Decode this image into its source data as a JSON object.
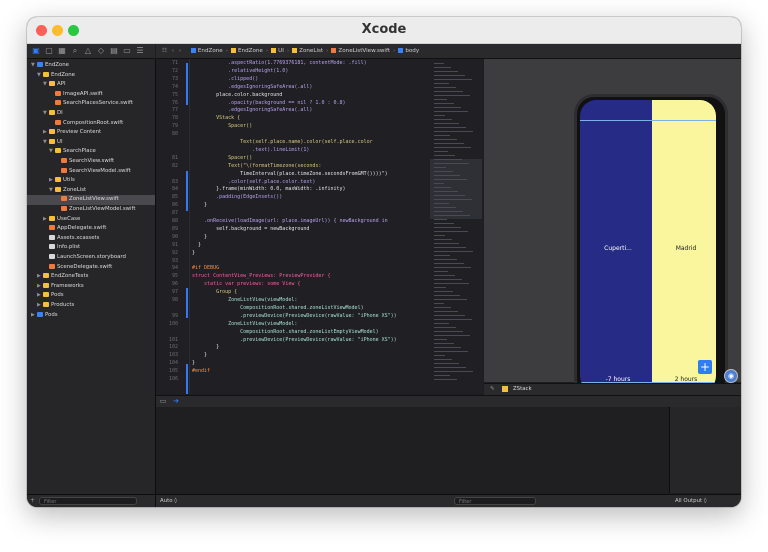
{
  "window": {
    "title": "Xcode"
  },
  "jumpbar": {
    "items": [
      "EndZone",
      "EndZone",
      "UI",
      "ZoneList",
      "ZoneListView.swift",
      "body"
    ]
  },
  "navigator": {
    "filter_placeholder": "Filter",
    "items": [
      {
        "label": "EndZone",
        "level": 0,
        "kind": "proj",
        "arrow": "▼"
      },
      {
        "label": "EndZone",
        "level": 1,
        "kind": "folder",
        "arrow": "▼"
      },
      {
        "label": "API",
        "level": 2,
        "kind": "folder",
        "arrow": "▼"
      },
      {
        "label": "ImageAPI.swift",
        "level": 3,
        "kind": "swift",
        "arrow": ""
      },
      {
        "label": "SearchPlacesService.swift",
        "level": 3,
        "kind": "swift",
        "arrow": ""
      },
      {
        "label": "DI",
        "level": 2,
        "kind": "folder",
        "arrow": "▼"
      },
      {
        "label": "CompositionRoot.swift",
        "level": 3,
        "kind": "swift",
        "arrow": ""
      },
      {
        "label": "Preview Content",
        "level": 2,
        "kind": "folder",
        "arrow": "▶"
      },
      {
        "label": "UI",
        "level": 2,
        "kind": "folder",
        "arrow": "▼"
      },
      {
        "label": "SearchPlace",
        "level": 3,
        "kind": "folder",
        "arrow": "▼"
      },
      {
        "label": "SearchView.swift",
        "level": 4,
        "kind": "swift",
        "arrow": ""
      },
      {
        "label": "SearchViewModel.swift",
        "level": 4,
        "kind": "swift",
        "arrow": ""
      },
      {
        "label": "Utils",
        "level": 3,
        "kind": "folder",
        "arrow": "▶"
      },
      {
        "label": "ZoneList",
        "level": 3,
        "kind": "folder",
        "arrow": "▼"
      },
      {
        "label": "ZoneListView.swift",
        "level": 4,
        "kind": "swift",
        "arrow": "",
        "selected": true
      },
      {
        "label": "ZoneListViewModel.swift",
        "level": 4,
        "kind": "swift",
        "arrow": ""
      },
      {
        "label": "UseCase",
        "level": 2,
        "kind": "folder",
        "arrow": "▶"
      },
      {
        "label": "AppDelegate.swift",
        "level": 2,
        "kind": "swift",
        "arrow": ""
      },
      {
        "label": "Assets.xcassets",
        "level": 2,
        "kind": "file",
        "arrow": ""
      },
      {
        "label": "Info.plist",
        "level": 2,
        "kind": "file",
        "arrow": ""
      },
      {
        "label": "LaunchScreen.storyboard",
        "level": 2,
        "kind": "file",
        "arrow": ""
      },
      {
        "label": "SceneDelegate.swift",
        "level": 2,
        "kind": "swift",
        "arrow": ""
      },
      {
        "label": "EndZoneTests",
        "level": 1,
        "kind": "folder",
        "arrow": "▶"
      },
      {
        "label": "Frameworks",
        "level": 1,
        "kind": "folder",
        "arrow": "▶"
      },
      {
        "label": "Pods",
        "level": 1,
        "kind": "folder",
        "arrow": "▶"
      },
      {
        "label": "Products",
        "level": 1,
        "kind": "folder",
        "arrow": "▶"
      },
      {
        "label": "Pods",
        "level": 0,
        "kind": "proj",
        "arrow": "▶"
      }
    ]
  },
  "code": {
    "lines": [
      {
        "num": "71",
        "text": "            .aspectRatio(1.7769376181, contentMode: .fill)"
      },
      {
        "num": "72",
        "text": "            .relativeHeight(1.0)"
      },
      {
        "num": "73",
        "text": "            .clipped()"
      },
      {
        "num": "74",
        "text": "            .edgesIgnoringSafeArea(.all)"
      },
      {
        "num": "75",
        "text": "        place.color.background"
      },
      {
        "num": "76",
        "text": "            .opacity(background == nil ? 1.0 : 0.8)"
      },
      {
        "num": "77",
        "text": "            .edgesIgnoringSafeArea(.all)"
      },
      {
        "num": "78",
        "text": "        VStack {"
      },
      {
        "num": "79",
        "text": "            Spacer()"
      },
      {
        "num": "80",
        "text": ""
      },
      {
        "num": "",
        "text": "                Text(self.place.name).color(self.place.color"
      },
      {
        "num": "",
        "text": "                    .text).lineLimit(1)"
      },
      {
        "num": "81",
        "text": "            Spacer()"
      },
      {
        "num": "82",
        "text": "            Text(\"\\(formatTimezone(seconds:"
      },
      {
        "num": "",
        "text": "                TimeInterval(place.timeZone.secondsFromGMT())))\")"
      },
      {
        "num": "83",
        "text": "            .color(self.place.color.text)"
      },
      {
        "num": "84",
        "text": "        }.frame(minWidth: 0.0, maxWidth: .infinity)"
      },
      {
        "num": "85",
        "text": "        .padding(EdgeInsets())"
      },
      {
        "num": "86",
        "text": "    }"
      },
      {
        "num": "87",
        "text": ""
      },
      {
        "num": "88",
        "text": "    .onReceive(loadImage(url: place.imageUrl)) { newBackground in"
      },
      {
        "num": "89",
        "text": "        self.background = newBackground"
      },
      {
        "num": "90",
        "text": "    }"
      },
      {
        "num": "91",
        "text": "  }"
      },
      {
        "num": "92",
        "text": "}"
      },
      {
        "num": "93",
        "text": ""
      },
      {
        "num": "94",
        "text": "#if DEBUG"
      },
      {
        "num": "95",
        "text": "struct ContentView_Previews: PreviewProvider {"
      },
      {
        "num": "96",
        "text": "    static var previews: some View {"
      },
      {
        "num": "97",
        "text": "        Group {"
      },
      {
        "num": "98",
        "text": "            ZoneListView(viewModel:"
      },
      {
        "num": "",
        "text": "                CompositionRoot.shared.zoneListViewModel)"
      },
      {
        "num": "99",
        "text": "                .previewDevice(PreviewDevice(rawValue: \"iPhone XS\"))"
      },
      {
        "num": "100",
        "text": "            ZoneListView(viewModel:"
      },
      {
        "num": "",
        "text": "                CompositionRoot.shared.zoneListEmptyViewModel)"
      },
      {
        "num": "101",
        "text": "                .previewDevice(PreviewDevice(rawValue: \"iPhone XS\"))"
      },
      {
        "num": "102",
        "text": "        }"
      },
      {
        "num": "103",
        "text": "    }"
      },
      {
        "num": "104",
        "text": "}"
      },
      {
        "num": "105",
        "text": "#endif"
      },
      {
        "num": "106",
        "text": ""
      }
    ]
  },
  "preview": {
    "left_city": "Cuperti...",
    "right_city": "Madrid",
    "left_hours": "-7 hours",
    "right_hours": "2 hours",
    "add_label": "+",
    "left_color": "#262b86",
    "right_color": "#f9f69e",
    "bottom_label": "ZStack"
  },
  "debug": {
    "auto_label": "Auto ◊",
    "filter_placeholder": "Filter",
    "output_label": "All Output ◊"
  }
}
